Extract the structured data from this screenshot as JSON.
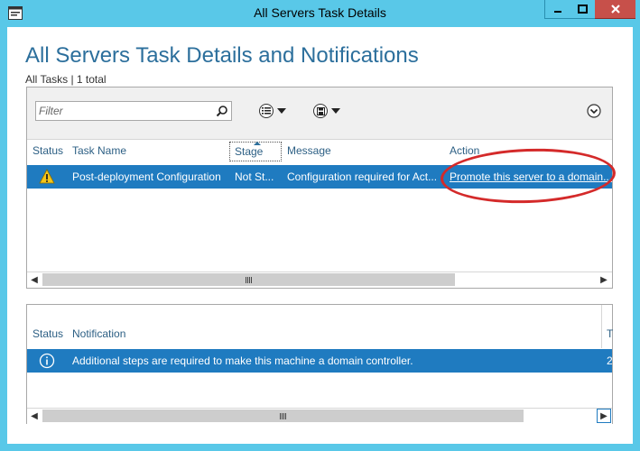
{
  "window": {
    "title": "All Servers Task Details",
    "accent": "#59c8e8",
    "close_color": "#c7504a"
  },
  "page": {
    "heading": "All Servers Task Details and Notifications",
    "subheading": "All Tasks | 1 total"
  },
  "tasks": {
    "filter_placeholder": "Filter",
    "columns": [
      "Status",
      "Task Name",
      "Stage",
      "Message",
      "Action"
    ],
    "rows": [
      {
        "status_icon": "warning-icon",
        "task_name": "Post-deployment Configuration",
        "stage": "Not St...",
        "message": "Configuration required for Act...",
        "action": "Promote this server to a domain..."
      }
    ],
    "selected_row_color": "#1f7bc0"
  },
  "notifications": {
    "columns": [
      "Status",
      "Notification"
    ],
    "rows": [
      {
        "status_icon": "info-icon",
        "notification": "Additional steps are required to make this machine a domain controller.",
        "trailing": "2"
      }
    ],
    "trailing_header": "T"
  },
  "annotation": {
    "color": "#d42a2a",
    "shape": "ellipse around action link"
  }
}
